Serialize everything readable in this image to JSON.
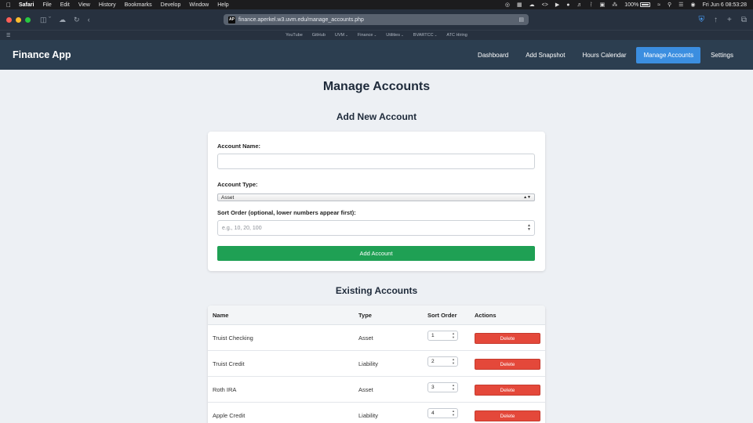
{
  "menubar": {
    "app_name": "Safari",
    "items": [
      "File",
      "Edit",
      "View",
      "History",
      "Bookmarks",
      "Develop",
      "Window",
      "Help"
    ],
    "battery_percent": "100%",
    "clock": "Fri Jun 6  08:53:28"
  },
  "browser": {
    "url": "finance.aperkel.w3.uvm.edu/manage_accounts.php",
    "favicon_text": "AP",
    "favorites": [
      {
        "label": "YouTube",
        "has_menu": false
      },
      {
        "label": "GitHub",
        "has_menu": false
      },
      {
        "label": "UVM",
        "has_menu": true
      },
      {
        "label": "Finance",
        "has_menu": true
      },
      {
        "label": "Utilities",
        "has_menu": true
      },
      {
        "label": "BVARTCC",
        "has_menu": true
      },
      {
        "label": "ATC Hiring",
        "has_menu": false
      }
    ]
  },
  "app": {
    "brand": "Finance App",
    "nav": [
      {
        "label": "Dashboard",
        "active": false
      },
      {
        "label": "Add Snapshot",
        "active": false
      },
      {
        "label": "Hours Calendar",
        "active": false
      },
      {
        "label": "Manage Accounts",
        "active": true
      },
      {
        "label": "Settings",
        "active": false
      }
    ]
  },
  "page": {
    "title": "Manage Accounts",
    "add_section_title": "Add New Account",
    "existing_section_title": "Existing Accounts"
  },
  "form": {
    "name_label": "Account Name:",
    "name_value": "",
    "type_label": "Account Type:",
    "type_value": "Asset",
    "sort_label": "Sort Order (optional, lower numbers appear first):",
    "sort_placeholder": "e.g., 10, 20, 100",
    "submit_label": "Add Account"
  },
  "table": {
    "headers": [
      "Name",
      "Type",
      "Sort Order",
      "Actions"
    ],
    "delete_label": "Delete",
    "rows": [
      {
        "name": "Truist Checking",
        "type": "Asset",
        "sort_order": "1"
      },
      {
        "name": "Truist Credit",
        "type": "Liability",
        "sort_order": "2"
      },
      {
        "name": "Roth IRA",
        "type": "Asset",
        "sort_order": "3"
      },
      {
        "name": "Apple Credit",
        "type": "Liability",
        "sort_order": "4"
      }
    ]
  },
  "colors": {
    "navbar_bg": "#2c3e50",
    "nav_active": "#3b8ee0",
    "add_button": "#1fa054",
    "delete_button": "#e4483a",
    "page_bg": "#edf0f4"
  }
}
